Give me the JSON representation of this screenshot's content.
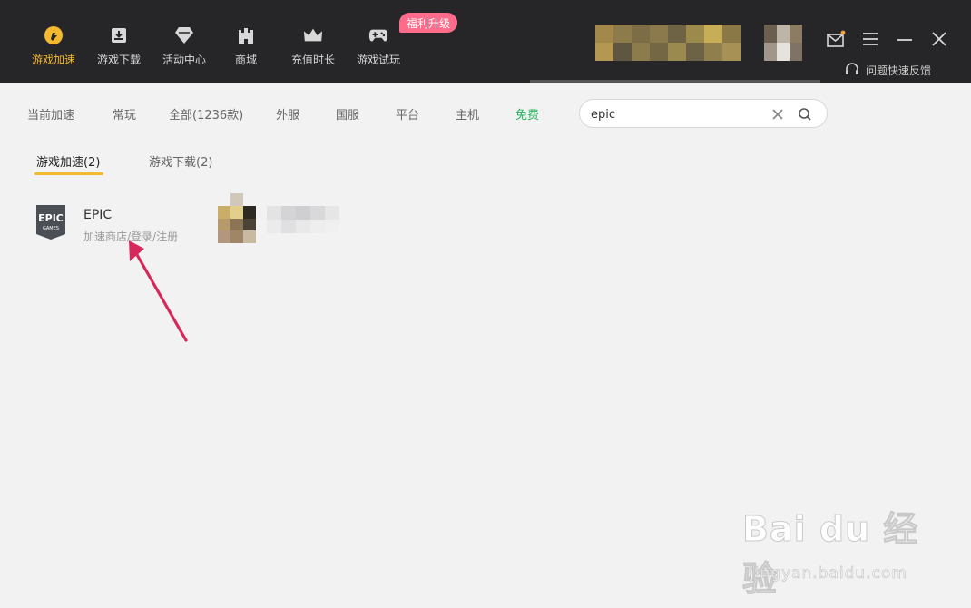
{
  "nav": {
    "items": [
      {
        "label": "游戏加速",
        "icon": "lightning-icon",
        "active": true
      },
      {
        "label": "游戏下载",
        "icon": "download-box-icon",
        "active": false
      },
      {
        "label": "活动中心",
        "icon": "diamond-icon",
        "active": false
      },
      {
        "label": "商城",
        "icon": "castle-icon",
        "active": false
      },
      {
        "label": "充值时长",
        "icon": "crown-icon",
        "active": false
      },
      {
        "label": "游戏试玩",
        "icon": "gamepad-icon",
        "active": false
      }
    ],
    "promo_badge": "福利升级"
  },
  "header": {
    "feedback_label": "问题快速反馈",
    "icons": [
      "mail-icon",
      "menu-icon",
      "minimize-icon",
      "close-icon"
    ],
    "mail_notification_color": "#f4a13a"
  },
  "filters": {
    "tabs": [
      "当前加速",
      "常玩",
      "全部(1236款)",
      "外服",
      "国服",
      "平台",
      "主机",
      "免费"
    ],
    "free_color": "#23b15a"
  },
  "search": {
    "value": "epic",
    "placeholder": ""
  },
  "subtabs": [
    {
      "label": "游戏加速(2)",
      "active": true
    },
    {
      "label": "游戏下载(2)",
      "active": false
    }
  ],
  "result": {
    "title": "EPIC",
    "subtitle": "加速商店/登录/注册",
    "logo_top": "EPIC",
    "logo_bottom": "GAMES"
  },
  "watermark": {
    "logo": "Bai du 经验",
    "url": "jingyan.baidu.com"
  },
  "colors": {
    "accent": "#f4b92e",
    "topbar": "#262628",
    "arrow": "#d6285a",
    "badge": "#ff6b8a"
  }
}
